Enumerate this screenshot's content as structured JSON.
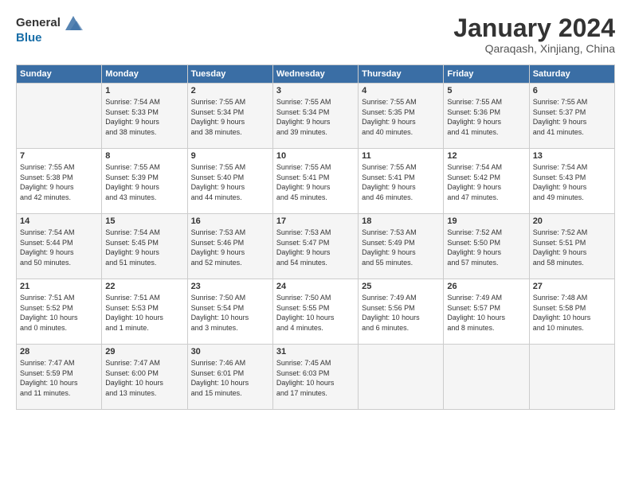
{
  "logo": {
    "line1": "General",
    "line2": "Blue"
  },
  "title": "January 2024",
  "location": "Qaraqash, Xinjiang, China",
  "header_days": [
    "Sunday",
    "Monday",
    "Tuesday",
    "Wednesday",
    "Thursday",
    "Friday",
    "Saturday"
  ],
  "weeks": [
    [
      {
        "day": "",
        "info": ""
      },
      {
        "day": "1",
        "info": "Sunrise: 7:54 AM\nSunset: 5:33 PM\nDaylight: 9 hours\nand 38 minutes."
      },
      {
        "day": "2",
        "info": "Sunrise: 7:55 AM\nSunset: 5:34 PM\nDaylight: 9 hours\nand 38 minutes."
      },
      {
        "day": "3",
        "info": "Sunrise: 7:55 AM\nSunset: 5:34 PM\nDaylight: 9 hours\nand 39 minutes."
      },
      {
        "day": "4",
        "info": "Sunrise: 7:55 AM\nSunset: 5:35 PM\nDaylight: 9 hours\nand 40 minutes."
      },
      {
        "day": "5",
        "info": "Sunrise: 7:55 AM\nSunset: 5:36 PM\nDaylight: 9 hours\nand 41 minutes."
      },
      {
        "day": "6",
        "info": "Sunrise: 7:55 AM\nSunset: 5:37 PM\nDaylight: 9 hours\nand 41 minutes."
      }
    ],
    [
      {
        "day": "7",
        "info": "Sunrise: 7:55 AM\nSunset: 5:38 PM\nDaylight: 9 hours\nand 42 minutes."
      },
      {
        "day": "8",
        "info": "Sunrise: 7:55 AM\nSunset: 5:39 PM\nDaylight: 9 hours\nand 43 minutes."
      },
      {
        "day": "9",
        "info": "Sunrise: 7:55 AM\nSunset: 5:40 PM\nDaylight: 9 hours\nand 44 minutes."
      },
      {
        "day": "10",
        "info": "Sunrise: 7:55 AM\nSunset: 5:41 PM\nDaylight: 9 hours\nand 45 minutes."
      },
      {
        "day": "11",
        "info": "Sunrise: 7:55 AM\nSunset: 5:41 PM\nDaylight: 9 hours\nand 46 minutes."
      },
      {
        "day": "12",
        "info": "Sunrise: 7:54 AM\nSunset: 5:42 PM\nDaylight: 9 hours\nand 47 minutes."
      },
      {
        "day": "13",
        "info": "Sunrise: 7:54 AM\nSunset: 5:43 PM\nDaylight: 9 hours\nand 49 minutes."
      }
    ],
    [
      {
        "day": "14",
        "info": "Sunrise: 7:54 AM\nSunset: 5:44 PM\nDaylight: 9 hours\nand 50 minutes."
      },
      {
        "day": "15",
        "info": "Sunrise: 7:54 AM\nSunset: 5:45 PM\nDaylight: 9 hours\nand 51 minutes."
      },
      {
        "day": "16",
        "info": "Sunrise: 7:53 AM\nSunset: 5:46 PM\nDaylight: 9 hours\nand 52 minutes."
      },
      {
        "day": "17",
        "info": "Sunrise: 7:53 AM\nSunset: 5:47 PM\nDaylight: 9 hours\nand 54 minutes."
      },
      {
        "day": "18",
        "info": "Sunrise: 7:53 AM\nSunset: 5:49 PM\nDaylight: 9 hours\nand 55 minutes."
      },
      {
        "day": "19",
        "info": "Sunrise: 7:52 AM\nSunset: 5:50 PM\nDaylight: 9 hours\nand 57 minutes."
      },
      {
        "day": "20",
        "info": "Sunrise: 7:52 AM\nSunset: 5:51 PM\nDaylight: 9 hours\nand 58 minutes."
      }
    ],
    [
      {
        "day": "21",
        "info": "Sunrise: 7:51 AM\nSunset: 5:52 PM\nDaylight: 10 hours\nand 0 minutes."
      },
      {
        "day": "22",
        "info": "Sunrise: 7:51 AM\nSunset: 5:53 PM\nDaylight: 10 hours\nand 1 minute."
      },
      {
        "day": "23",
        "info": "Sunrise: 7:50 AM\nSunset: 5:54 PM\nDaylight: 10 hours\nand 3 minutes."
      },
      {
        "day": "24",
        "info": "Sunrise: 7:50 AM\nSunset: 5:55 PM\nDaylight: 10 hours\nand 4 minutes."
      },
      {
        "day": "25",
        "info": "Sunrise: 7:49 AM\nSunset: 5:56 PM\nDaylight: 10 hours\nand 6 minutes."
      },
      {
        "day": "26",
        "info": "Sunrise: 7:49 AM\nSunset: 5:57 PM\nDaylight: 10 hours\nand 8 minutes."
      },
      {
        "day": "27",
        "info": "Sunrise: 7:48 AM\nSunset: 5:58 PM\nDaylight: 10 hours\nand 10 minutes."
      }
    ],
    [
      {
        "day": "28",
        "info": "Sunrise: 7:47 AM\nSunset: 5:59 PM\nDaylight: 10 hours\nand 11 minutes."
      },
      {
        "day": "29",
        "info": "Sunrise: 7:47 AM\nSunset: 6:00 PM\nDaylight: 10 hours\nand 13 minutes."
      },
      {
        "day": "30",
        "info": "Sunrise: 7:46 AM\nSunset: 6:01 PM\nDaylight: 10 hours\nand 15 minutes."
      },
      {
        "day": "31",
        "info": "Sunrise: 7:45 AM\nSunset: 6:03 PM\nDaylight: 10 hours\nand 17 minutes."
      },
      {
        "day": "",
        "info": ""
      },
      {
        "day": "",
        "info": ""
      },
      {
        "day": "",
        "info": ""
      }
    ]
  ]
}
